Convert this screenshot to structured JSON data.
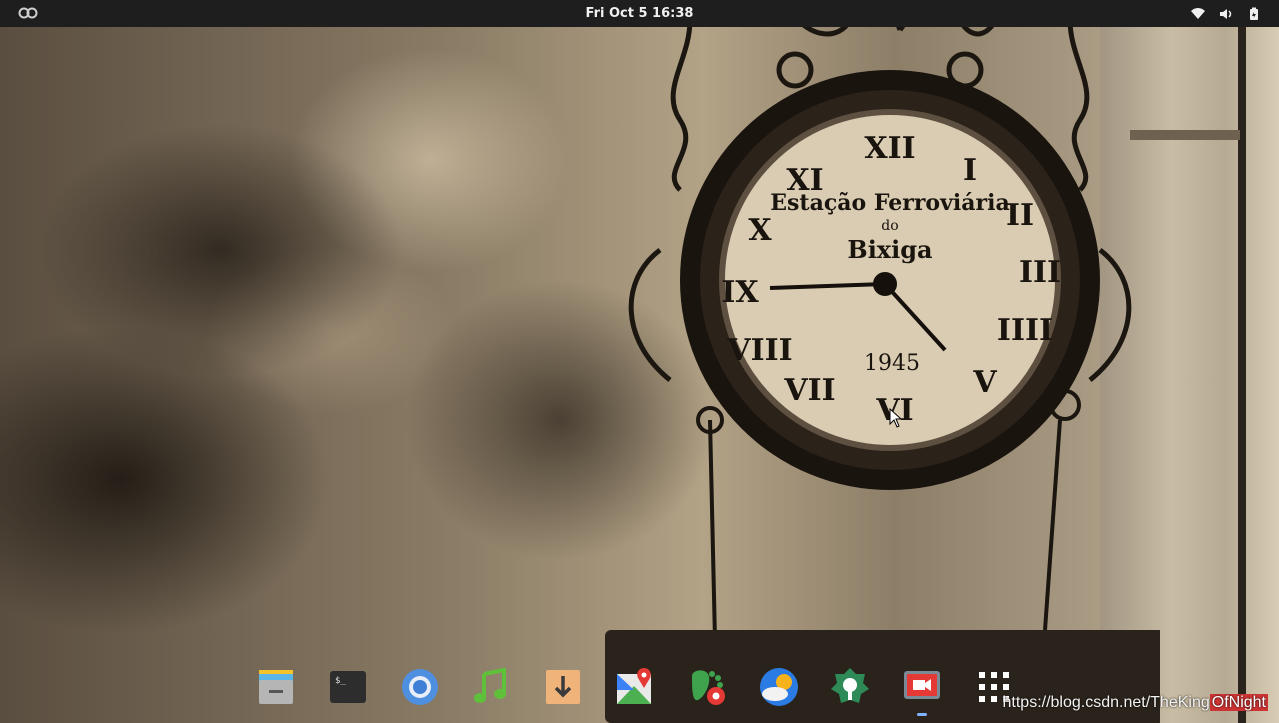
{
  "topbar": {
    "activities_icon": "activities-icon",
    "datetime": "Fri Oct 5  16:38",
    "status_icons": [
      "wifi-icon",
      "volume-icon",
      "battery-icon"
    ]
  },
  "wallpaper": {
    "clock_text_top": "Estação Ferroviária",
    "clock_text_do": "do",
    "clock_text_name": "Bixiga",
    "clock_year": "1945"
  },
  "dock": {
    "items": [
      {
        "name": "files",
        "icon": "files-icon"
      },
      {
        "name": "terminal",
        "icon": "terminal-icon"
      },
      {
        "name": "chromium",
        "icon": "browser-icon"
      },
      {
        "name": "music",
        "icon": "music-icon"
      },
      {
        "name": "downloads",
        "icon": "download-icon"
      },
      {
        "name": "maps",
        "icon": "maps-icon"
      },
      {
        "name": "software-settings",
        "icon": "gear-icon"
      },
      {
        "name": "weather",
        "icon": "weather-icon"
      },
      {
        "name": "tweaks",
        "icon": "tweaks-icon"
      },
      {
        "name": "screen-recorder",
        "icon": "video-icon",
        "running": true
      },
      {
        "name": "app-grid",
        "icon": "app-grid-icon"
      }
    ]
  },
  "watermark": {
    "text": "https://blog.csdn.net/TheKing",
    "tail": "OfNight"
  },
  "colors": {
    "topbar": "#1e1e1e",
    "running_indicator": "#7fb2ff"
  }
}
